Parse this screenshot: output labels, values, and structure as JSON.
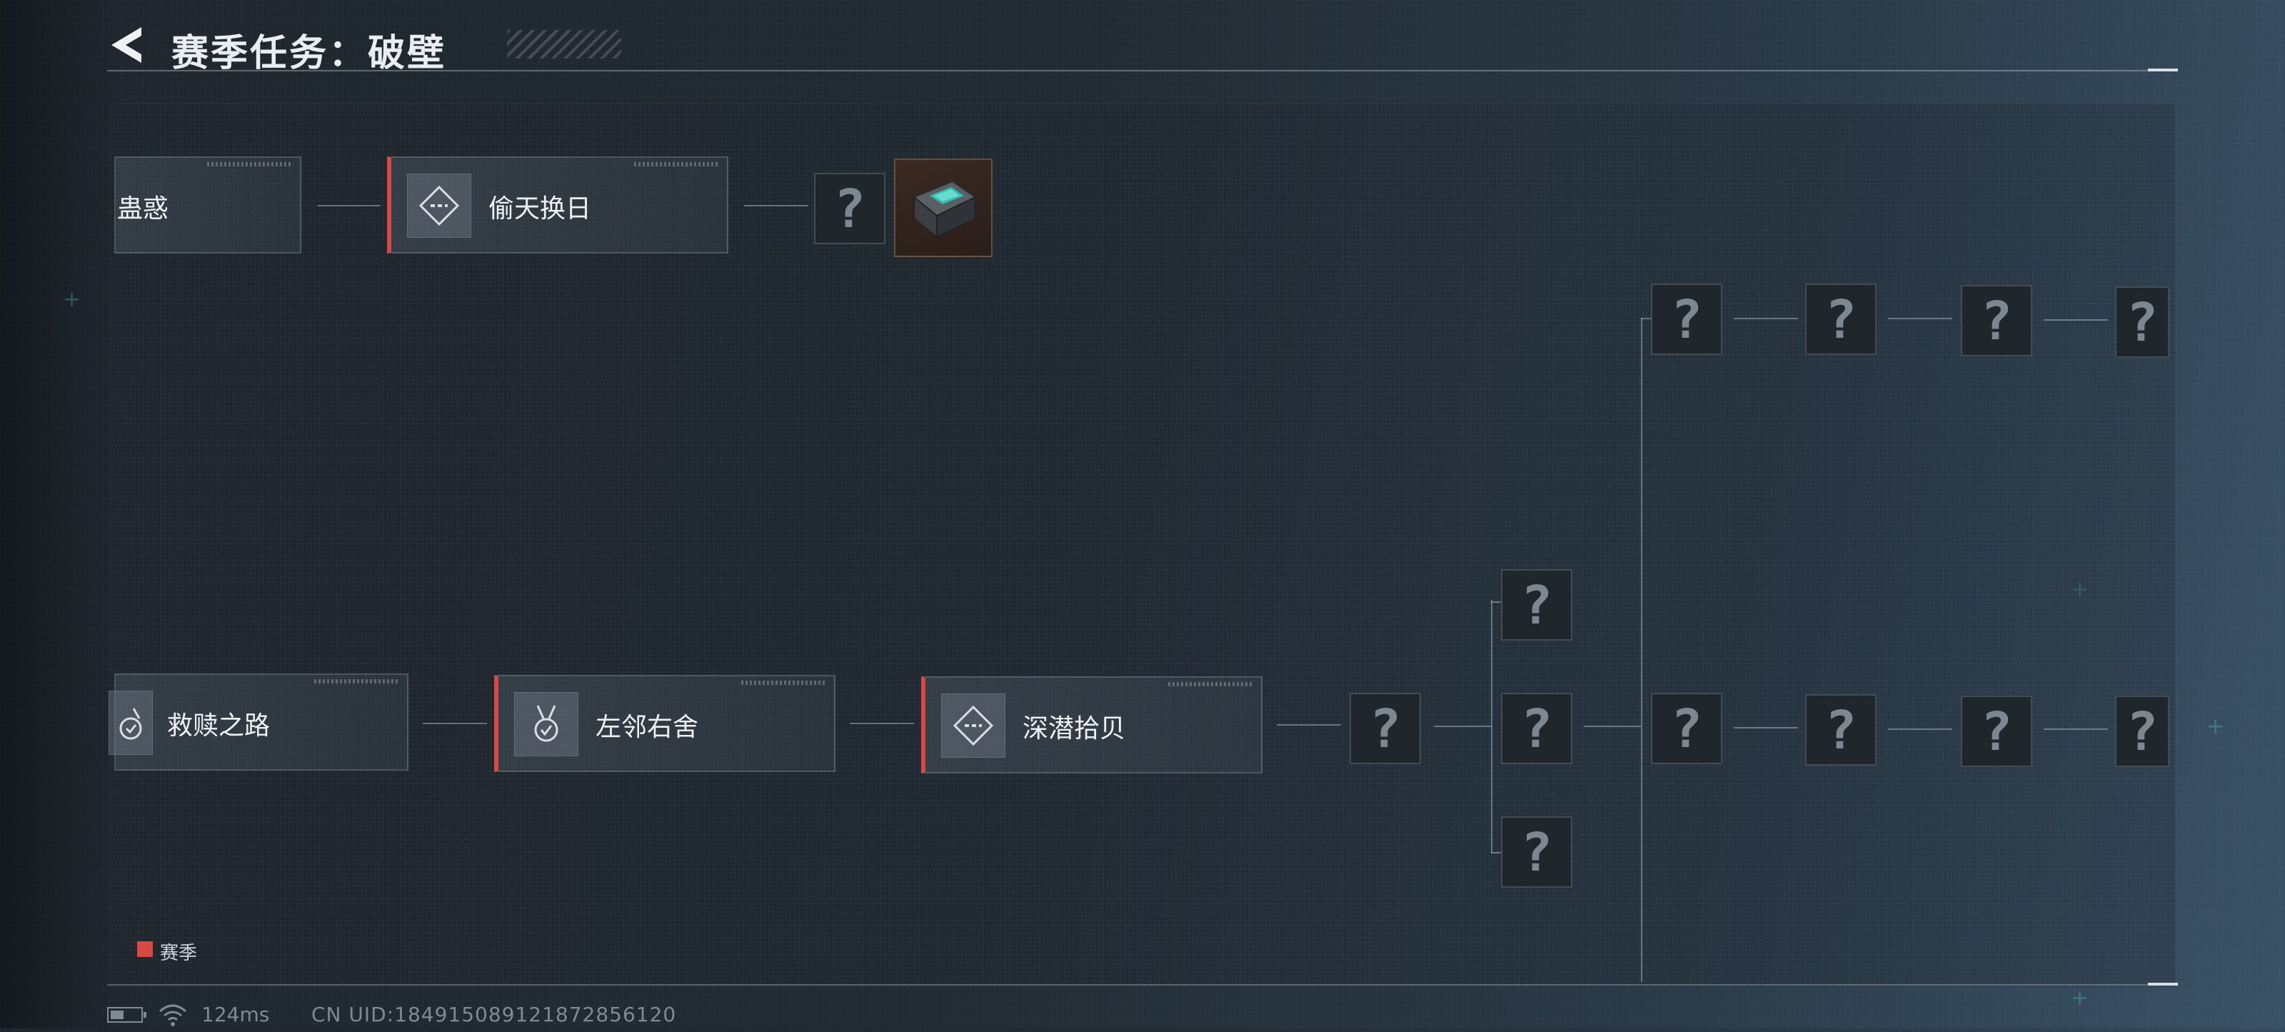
{
  "header": {
    "title": "赛季任务：破壁"
  },
  "quests": [
    {
      "id": "gu-huo",
      "label": "蛊惑",
      "season": false
    },
    {
      "id": "tou-tian-huan-ri",
      "label": "偷天换日",
      "season": true
    },
    {
      "id": "jiu-shu-zhi-lu",
      "label": "救赎之路",
      "season": false
    },
    {
      "id": "zuo-lin-you-she",
      "label": "左邻右舍",
      "season": true
    },
    {
      "id": "shen-qian-shi-bei",
      "label": "深潜拾贝",
      "season": true
    }
  ],
  "unknown_symbol": "?",
  "legend": {
    "label": "赛季",
    "color": "#d64a43"
  },
  "status": {
    "ping": "124ms",
    "uid": "CN UID:18491508912187285612​0"
  },
  "colors": {
    "accent": "#d64a43",
    "background": "#222b33"
  }
}
